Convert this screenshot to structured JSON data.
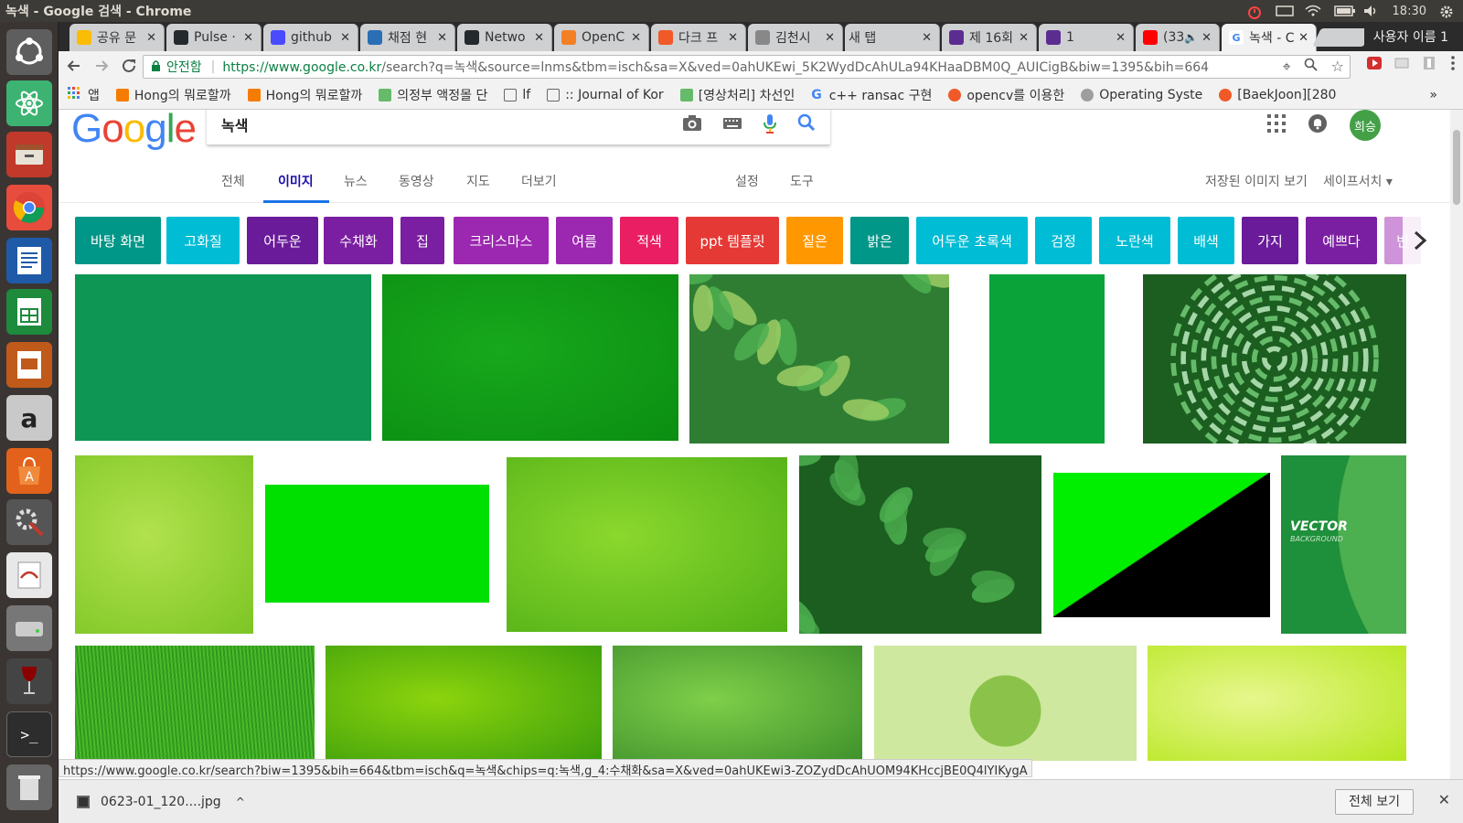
{
  "window_title": "녹색 - Google 검색 - Chrome",
  "system": {
    "time": "18:30"
  },
  "tabs": [
    {
      "label": "공유 문",
      "color": "#fbbc05"
    },
    {
      "label": "Pulse ·",
      "color": "#24292e"
    },
    {
      "label": "github",
      "color": "#4a4aff"
    },
    {
      "label": "채점 현",
      "color": "#2a6fb4"
    },
    {
      "label": "Netwo",
      "color": "#24292e"
    },
    {
      "label": "OpenC",
      "color": "#f48024"
    },
    {
      "label": "다크 프",
      "color": "#f05a28"
    },
    {
      "label": "김천시",
      "color": "#888888"
    },
    {
      "label": "새 탭",
      "color": "#cccccc"
    },
    {
      "label": "제 16회",
      "color": "#5c2d91"
    },
    {
      "label": "1",
      "color": "#5c2d91"
    },
    {
      "label": "(33)",
      "color": "#ff0000"
    },
    {
      "label": "녹색 - C",
      "color": "#4285f4"
    }
  ],
  "profile_label": "사용자 이름 1",
  "omnibox": {
    "secure_label": "안전함",
    "url_host": "https://www.google.co.kr",
    "url_rest": "/search?q=녹색&source=lnms&tbm=isch&sa=X&ved=0ahUKEwi_5K2WydDcAhULa94KHaaDBM0Q_AUICigB&biw=1395&bih=664"
  },
  "bookmarks": [
    {
      "label": "앱",
      "color": "#f44336"
    },
    {
      "label": "Hong의 뭐로할까",
      "color": "#f57c00"
    },
    {
      "label": "Hong의 뭐로할까",
      "color": "#f57c00"
    },
    {
      "label": "의정부 액정몰 단",
      "color": "#66bb6a"
    },
    {
      "label": "lf",
      "color": "#ffffff"
    },
    {
      "label": ":: Journal of Kor",
      "color": "#ffffff"
    },
    {
      "label": "[영상처리] 차선인",
      "color": "#66bb6a"
    },
    {
      "label": "c++ ransac 구현",
      "color": "#4285f4"
    },
    {
      "label": "opencv를 이용한",
      "color": "#f05a28"
    },
    {
      "label": "Operating Syste",
      "color": "#9e9e9e"
    },
    {
      "label": "[BaekJoon][280",
      "color": "#f05a28"
    }
  ],
  "bookmarks_more": "»",
  "google": {
    "logo_letters": [
      "G",
      "o",
      "o",
      "g",
      "l",
      "e"
    ],
    "logo_colors": [
      "#4285f4",
      "#ea4335",
      "#fbbc05",
      "#4285f4",
      "#34a853",
      "#ea4335"
    ],
    "query": "녹색",
    "avatar_label": "희승"
  },
  "search_tabs": [
    "전체",
    "이미지",
    "뉴스",
    "동영상",
    "지도",
    "더보기",
    "설정",
    "도구"
  ],
  "search_tabs_right": [
    "저장된 이미지 보기",
    "세이프서치 ▾"
  ],
  "chips": [
    {
      "label": "바탕 화면",
      "color": "#009688"
    },
    {
      "label": "고화질",
      "color": "#00bcd4"
    },
    {
      "label": "어두운",
      "color": "#6a1b9a"
    },
    {
      "label": "수채화",
      "color": "#7b1fa2"
    },
    {
      "label": "집",
      "color": "#7b1fa2"
    },
    {
      "label": "크리스마스",
      "color": "#9c27b0"
    },
    {
      "label": "여름",
      "color": "#9c27b0"
    },
    {
      "label": "적색",
      "color": "#e91e63"
    },
    {
      "label": "ppt 템플릿",
      "color": "#e53935"
    },
    {
      "label": "짙은",
      "color": "#ff9800"
    },
    {
      "label": "밝은",
      "color": "#009688"
    },
    {
      "label": "어두운 초록색",
      "color": "#00bcd4"
    },
    {
      "label": "검정",
      "color": "#00bcd4"
    },
    {
      "label": "노란색",
      "color": "#00bcd4"
    },
    {
      "label": "배색",
      "color": "#00bcd4"
    },
    {
      "label": "가지",
      "color": "#6a1b9a"
    },
    {
      "label": "예쁘다",
      "color": "#7b1fa2"
    },
    {
      "label": "빈",
      "color": "#ce93d8"
    }
  ],
  "images": [
    {
      "kind": "solid",
      "colors": [
        "#0e9654",
        "#0e9654"
      ]
    },
    {
      "kind": "gradient",
      "colors": [
        "#17a81c",
        "#0b8e12"
      ]
    },
    {
      "kind": "leaves",
      "colors": [
        "#2e7d32",
        "#9ccc65"
      ]
    },
    {
      "kind": "solid",
      "colors": [
        "#0aa33a",
        "#0aa33a"
      ]
    },
    {
      "kind": "swirl",
      "colors": [
        "#1b5e20",
        "#66bb6a"
      ]
    },
    {
      "kind": "gradient",
      "colors": [
        "#b2e24e",
        "#7cc524"
      ]
    },
    {
      "kind": "solid",
      "colors": [
        "#00e000",
        "#00e000"
      ]
    },
    {
      "kind": "gradient",
      "colors": [
        "#8bd82e",
        "#52b016"
      ]
    },
    {
      "kind": "leaves",
      "colors": [
        "#1b5e20",
        "#43a047"
      ]
    },
    {
      "kind": "diagonal",
      "colors": [
        "#00ee00",
        "#000000"
      ]
    },
    {
      "kind": "vector",
      "colors": [
        "#1e8f3a",
        "#4caf50"
      ]
    },
    {
      "kind": "grass",
      "colors": [
        "#2e9a1c",
        "#4db82b"
      ]
    },
    {
      "kind": "gradient",
      "colors": [
        "#8cd40d",
        "#3a9c0c"
      ]
    },
    {
      "kind": "gradient",
      "colors": [
        "#7fcf4a",
        "#3d8f2a"
      ]
    },
    {
      "kind": "globe",
      "colors": [
        "#8bc34a",
        "#cfe8a0"
      ]
    },
    {
      "kind": "gradient",
      "colors": [
        "#e7f78d",
        "#b5e61d"
      ]
    }
  ],
  "vector_text": {
    "title": "VECTOR",
    "subtitle": "BACKGROUND"
  },
  "status_url": "https://www.google.co.kr/search?biw=1395&bih=664&tbm=isch&q=녹색&chips=q:녹색,g_4:수채화&sa=X&ved=0ahUKEwi3-ZOZydDcAhUOM94KHccjBE0Q4lYIKygA",
  "download": {
    "filename": "0623-01_120....jpg",
    "chevron": "^"
  },
  "shelf": {
    "show_all": "전체 보기",
    "close": "✕"
  }
}
